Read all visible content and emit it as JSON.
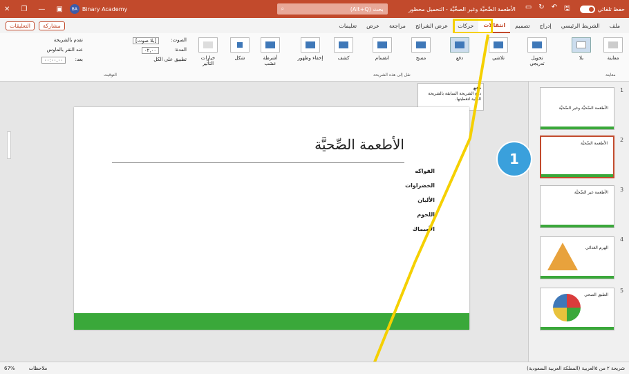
{
  "titlebar": {
    "autosave": "حفظ تلقائي",
    "title": "الأطعمة الصِّحيَّة وغير الصحِّيَّة - التحميل محظور",
    "search": "بحث (Alt+Q)",
    "user": "Binary Academy",
    "user_initials": "BA"
  },
  "tabs": [
    "ملف",
    "الشريط الرئيسي",
    "إدراج",
    "تصميم",
    "انتقالات",
    "حركات",
    "عرض الشرائح",
    "مراجعة",
    "عرض",
    "تعليمات"
  ],
  "active_tab": "انتقالات",
  "share": "مشاركة",
  "comments": "التعليقات",
  "ribbon": {
    "preview_label": "معاينة",
    "preview_group": "معاينة",
    "effects": [
      "بلا",
      "تحويل تدريجي",
      "تلاشي",
      "دفع",
      "مسح",
      "انقسام",
      "كشف",
      "إخفاء وظهور",
      "أشرطة عشب",
      "شكل"
    ],
    "effect_options": "خيارات التأثير",
    "group_transition": "نقل إلى هذه الشريحة",
    "group_timing": "التوقيت",
    "sound_label": "الصوت:",
    "sound_value": "[بلا صوت]",
    "duration_label": "المدة:",
    "duration_value": "٠٢,٠٠",
    "apply_all": "تطبيق على الكل",
    "advance_label": "تقدم بالشريحة",
    "on_click": "عند النقر بالماوس",
    "after_label": "بعد:",
    "after_value": "٠٠:٠٠,٠٠"
  },
  "tooltip": {
    "title": "دفع",
    "text": "دفع الشريحة السابقة بالشريحة التالية لتغطيتها."
  },
  "slide": {
    "title": "الأطعمة الصِّحيَّة",
    "bullets": [
      "الفواكه",
      "الخضراوات",
      "الألبان",
      "اللحوم",
      "الأسماك"
    ]
  },
  "thumbnails": [
    {
      "num": "1",
      "text": "الأطعمة الصِّحيَّة وغير الصِّحيَّة"
    },
    {
      "num": "2",
      "text": "الأطعمة الصِّحيَّة"
    },
    {
      "num": "3",
      "text": "الأطعمة غير الصِّحيَّة"
    },
    {
      "num": "4",
      "text": "الهرم الغذائي"
    },
    {
      "num": "5",
      "text": "الطبق الصحي"
    }
  ],
  "badge": "1",
  "status": {
    "slide_count": "شريحة ٢ من ٥",
    "language": "العربية (المملكة العربية السعودية)",
    "notes": "ملاحظات",
    "zoom": "67%"
  },
  "colors": {
    "accent": "#c24a2c",
    "green": "#3aa83a",
    "badge": "#3aa0dc",
    "highlight": "#f5d000"
  }
}
